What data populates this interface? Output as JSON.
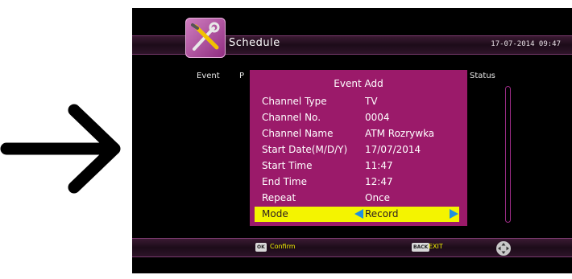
{
  "header": {
    "title": "Schedule",
    "datetime": "17-07-2014 09:47",
    "icon": "tools-icon"
  },
  "columns": {
    "event": "Event",
    "program": "P",
    "status": "Status",
    "partial": ":"
  },
  "dialog": {
    "title": "Event Add",
    "rows": [
      {
        "label": "Channel Type",
        "value": "TV"
      },
      {
        "label": "Channel No.",
        "value": "0004"
      },
      {
        "label": "Channel Name",
        "value": "ATM Rozrywka"
      },
      {
        "label": "Start Date(M/D/Y)",
        "value": "17/07/2014"
      },
      {
        "label": "Start Time",
        "value": "11:47"
      },
      {
        "label": "End Time",
        "value": "12:47"
      },
      {
        "label": "Repeat",
        "value": "Once"
      },
      {
        "label": "Mode",
        "value": "Record"
      }
    ]
  },
  "footer": {
    "ok_key": "OK",
    "confirm": "Confirm",
    "back_key": "BACK",
    "exit": "EXIT",
    "nav_icon": "dpad-icon"
  },
  "colors": {
    "dialog": "#9b1a6a",
    "highlight": "#f4f400",
    "arrow": "#1f8fe0"
  }
}
